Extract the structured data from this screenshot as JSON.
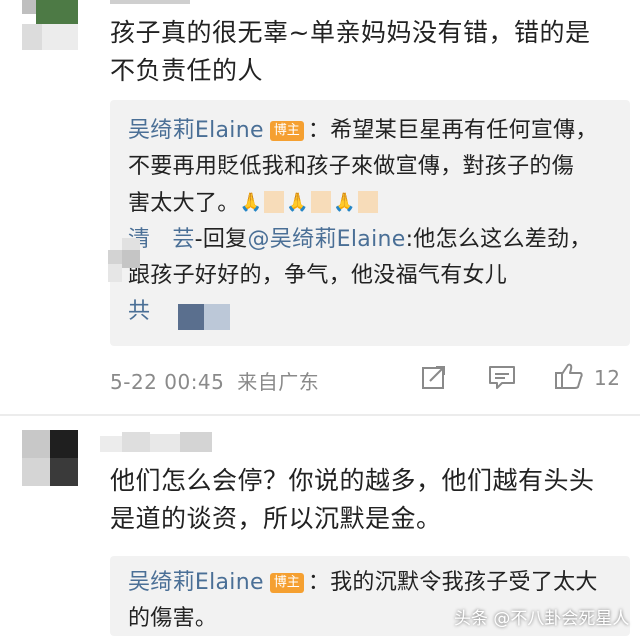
{
  "top_comment": {
    "text_line1": "孩子真的很无辜~单亲妈妈没有错，错的是",
    "text_line2": "不负责任的人"
  },
  "quote1": {
    "author": "吴绮莉Elaine",
    "badge": "博主",
    "line1_rest": "：希望某巨星再有任何宣傳，",
    "line2": "不要再用貶低我和孩子來做宣傳，對孩子的傷",
    "line3": "害太大了。",
    "emoji_hands": "🙏",
    "reply_prefix": "清",
    "reply_name_tail": "芸",
    "reply_verb": "-回复",
    "reply_target": "@吴绮莉Elaine",
    "reply_text1": ":他怎么这么差劲，",
    "reply_text2": "跟孩子好好的，争气，他没福气有女儿",
    "total_label": "共"
  },
  "meta": {
    "timestamp": "5-22 00:45",
    "source": "来自广东",
    "like_count": "12"
  },
  "second_comment": {
    "text_line1": "他们怎么会停？你说的越多，他们越有头头",
    "text_line2": "是道的谈资，所以沉默是金。"
  },
  "quote2": {
    "author": "吴绮莉Elaine",
    "badge": "博主",
    "line1_rest": "：我的沉默令我孩子受了太大",
    "line2": "的傷害。"
  },
  "watermark": "头条 @不八卦会死星人",
  "colors": {
    "link": "#4a6f96",
    "badge": "#f5a031",
    "quote_bg": "#f2f2f2",
    "meta_text": "#8a8a8a"
  }
}
